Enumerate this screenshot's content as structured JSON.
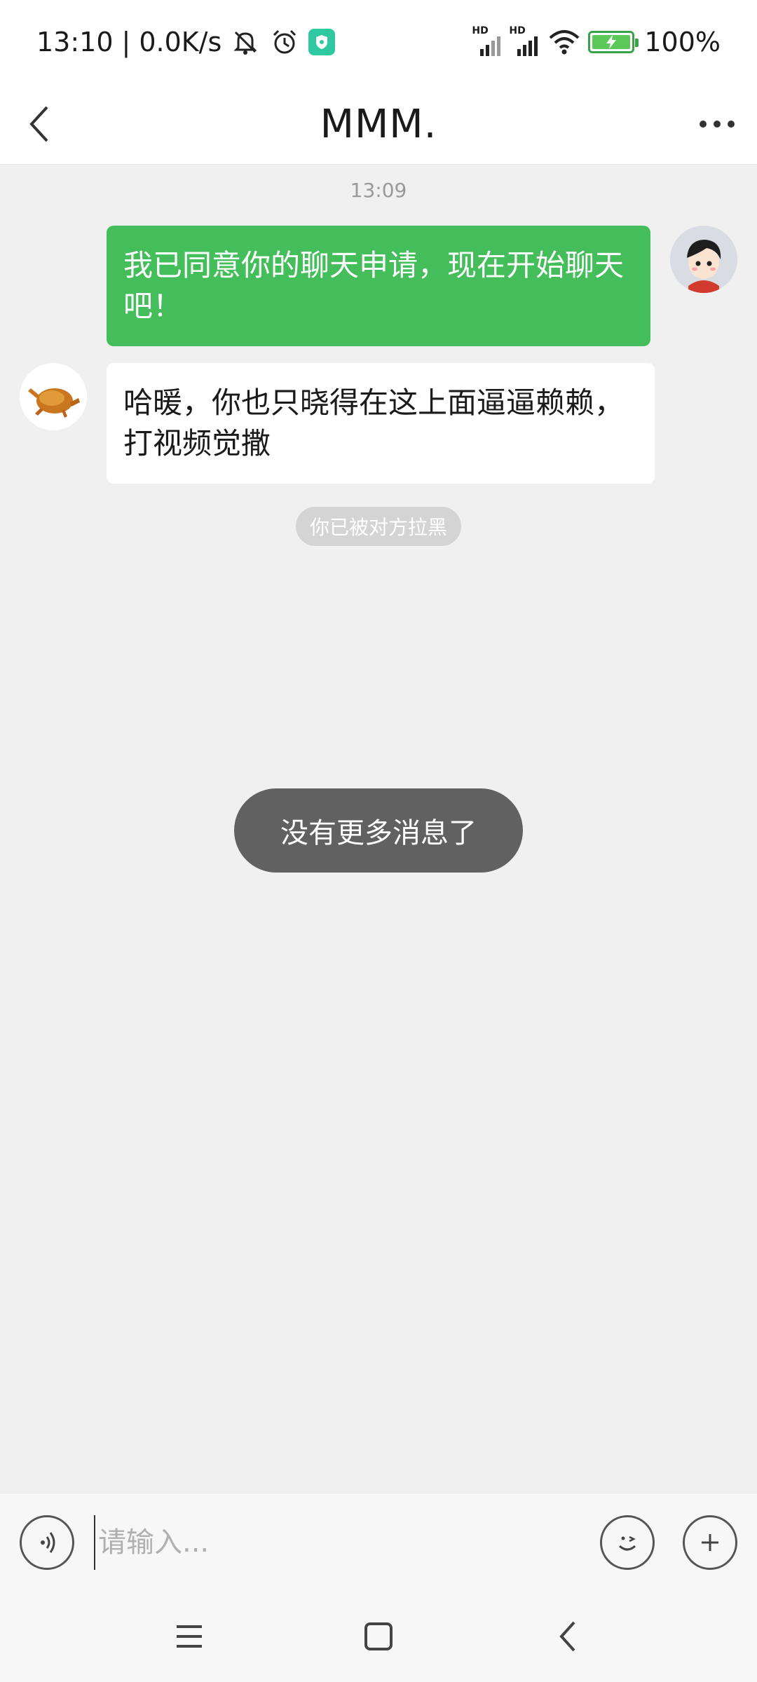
{
  "status_bar": {
    "time": "13:10",
    "separator": "|",
    "net_speed": "0.0K/s",
    "signal1_label": "HD",
    "signal2_label": "HD",
    "battery_text": "100%",
    "icons": [
      "mute-icon",
      "alarm-icon",
      "shield-badge-icon",
      "signal-icon",
      "signal-icon",
      "wifi-icon",
      "battery-icon"
    ],
    "colors": {
      "battery": "#5dc85a",
      "badge": "#2fc8a0"
    }
  },
  "header": {
    "title": "MMM.",
    "back_icon": "chevron-left-icon",
    "more_icon": "more-dots-icon"
  },
  "chat": {
    "timestamp": "13:09",
    "messages": [
      {
        "side": "sent",
        "text": "我已同意你的聊天申请，现在开始聊天吧！",
        "avatar": "cartoon-boy-avatar"
      },
      {
        "side": "received",
        "text": "哈暖，你也只晓得在这上面逼逼赖赖，打视频觉撒",
        "avatar": "roast-chicken-avatar"
      }
    ],
    "system_notice": "你已被对方拉黑",
    "toast": "没有更多消息了",
    "colors": {
      "sent_bubble": "#43be5a",
      "received_bubble": "#ffffff",
      "toast": "#616161"
    }
  },
  "input_bar": {
    "placeholder": "请输入...",
    "voice_icon": "voice-icon",
    "emoji_icon": "emoji-icon",
    "plus_icon": "plus-icon"
  },
  "nav_bar": {
    "icons": [
      "menu-icon",
      "home-icon",
      "back-icon"
    ]
  }
}
